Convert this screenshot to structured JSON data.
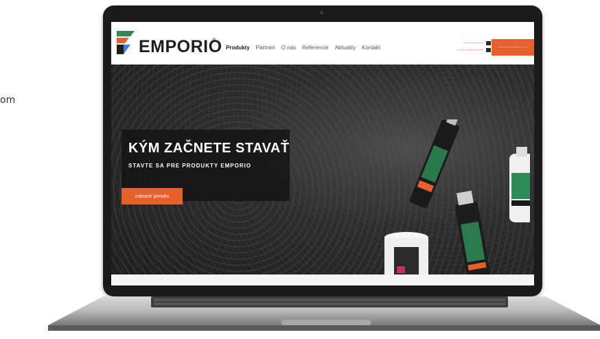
{
  "side_text": "om",
  "site": {
    "brand": "EMPORIO",
    "reg_mark": "®",
    "nav": [
      "Produkty",
      "Partneri",
      "O nás",
      "Referencie",
      "Aktuality",
      "Kontakt"
    ],
    "contact_lines": [
      "—————",
      "—— —— ——"
    ],
    "cta_label": "—————— ——",
    "hero": {
      "title": "KÝM ZAČNETE STAVAŤ",
      "subtitle": "STAVTE SA PRE PRODUKTY EMPORIO",
      "button": "zobraziť ponuku"
    }
  },
  "colors": {
    "accent": "#e8612c",
    "dark": "#1e1e1e"
  },
  "icons": [
    "emporio-logo-icon",
    "mail-icon",
    "phone-icon"
  ]
}
